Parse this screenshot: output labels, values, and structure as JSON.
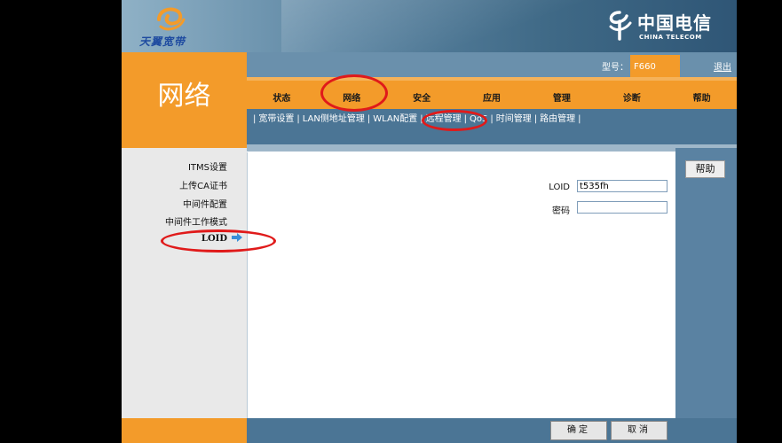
{
  "brand": {
    "left_logo_text": "天翼宽带",
    "right_logo_cn": "中国电信",
    "right_logo_en": "CHINA TELECOM"
  },
  "section_title": "网络",
  "header": {
    "model_label": "型号：",
    "model_value": "F660",
    "logout": "退出"
  },
  "main_tabs": [
    {
      "label": "状态"
    },
    {
      "label": "网络"
    },
    {
      "label": "安全"
    },
    {
      "label": "应用"
    },
    {
      "label": "管理"
    },
    {
      "label": "诊断"
    },
    {
      "label": "帮助"
    }
  ],
  "sub_tabs": [
    {
      "label": "宽带设置"
    },
    {
      "label": "LAN侧地址管理"
    },
    {
      "label": "WLAN配置"
    },
    {
      "label": "远程管理"
    },
    {
      "label": "QoS"
    },
    {
      "label": "时间管理"
    },
    {
      "label": "路由管理"
    }
  ],
  "left_menu": [
    {
      "label": "ITMS设置"
    },
    {
      "label": "上传CA证书"
    },
    {
      "label": "中间件配置"
    },
    {
      "label": "中间件工作模式"
    },
    {
      "label": "LOID"
    }
  ],
  "form": {
    "loid_label": "LOID",
    "loid_value": "t535fh",
    "password_label": "密码",
    "password_value": ""
  },
  "help_button": "帮助",
  "footer": {
    "confirm": "确定",
    "cancel": "取消"
  },
  "colors": {
    "orange": "#f39b2a",
    "nav_blue": "#4b7595",
    "annotation_red": "#e01a1a"
  }
}
